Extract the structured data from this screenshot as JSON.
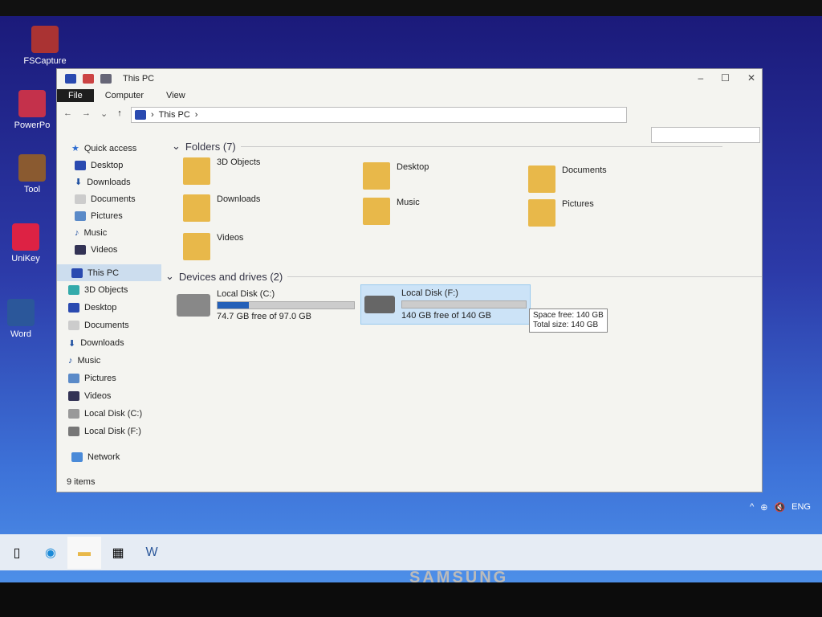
{
  "desktop": {
    "icons": [
      {
        "label": "FSCapture"
      },
      {
        "label": "PowerPo"
      },
      {
        "label": "Tool"
      },
      {
        "label": "UniKey"
      },
      {
        "label": "Word"
      }
    ]
  },
  "window": {
    "title": "This PC",
    "ribbon": [
      "File",
      "Computer",
      "View"
    ],
    "address": [
      "This PC"
    ],
    "min": "–",
    "max": "☐",
    "close": "✕"
  },
  "sidebar": {
    "quick_access": "Quick access",
    "quick": [
      "Desktop",
      "Downloads",
      "Documents",
      "Pictures",
      "Music",
      "Videos"
    ],
    "this_pc": "This PC",
    "pc": [
      "3D Objects",
      "Desktop",
      "Documents",
      "Downloads",
      "Music",
      "Pictures",
      "Videos",
      "Local Disk (C:)",
      "Local Disk (F:)"
    ],
    "network": "Network"
  },
  "folders": {
    "header": "Folders (7)",
    "items": [
      "3D Objects",
      "Desktop",
      "Documents",
      "Downloads",
      "Music",
      "Pictures",
      "Videos"
    ]
  },
  "drives": {
    "header": "Devices and drives (2)",
    "items": [
      {
        "name": "Local Disk (C:)",
        "free": "74.7 GB free of 97.0 GB",
        "used_fraction": 0.23
      },
      {
        "name": "Local Disk (F:)",
        "free": "140 GB free of 140 GB",
        "used_fraction": 0.0
      }
    ]
  },
  "tooltip": {
    "line1": "Space free: 140 GB",
    "line2": "Total size: 140 GB"
  },
  "status": "9 items",
  "tray": {
    "lang": "ENG"
  },
  "monitor_brand": "SAMSUNG"
}
